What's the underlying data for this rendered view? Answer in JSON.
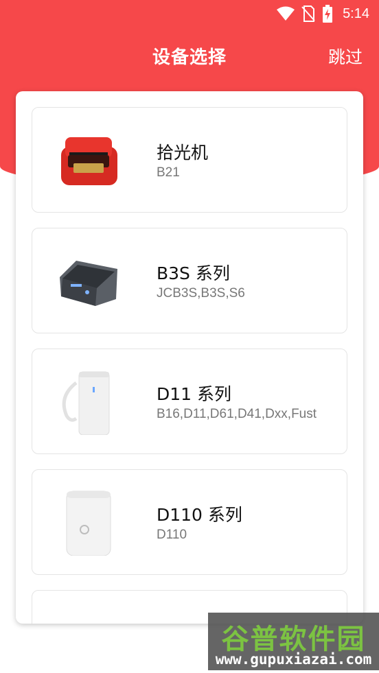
{
  "status_bar": {
    "time": "5:14",
    "icons": [
      "wifi-icon",
      "no-sim-icon",
      "battery-charging-icon"
    ]
  },
  "header": {
    "title": "设备选择",
    "skip_label": "跳过"
  },
  "devices": [
    {
      "name": "拾光机",
      "models": "B21",
      "icon": "red-label-printer-icon"
    },
    {
      "name": "B3S 系列",
      "models": "JCB3S,B3S,S6",
      "icon": "gray-portable-printer-icon"
    },
    {
      "name": "D11 系列",
      "models": "B16,D11,D61,D41,Dxx,Fust",
      "icon": "white-handheld-printer-icon"
    },
    {
      "name": "D110 系列",
      "models": "D110",
      "icon": "white-mini-printer-icon"
    }
  ],
  "watermark": {
    "title": "谷普软件园",
    "url": "www.gupuxiazai.com"
  },
  "colors": {
    "header_red": "#f6484a",
    "text_primary": "#111111",
    "text_secondary": "#777777"
  }
}
